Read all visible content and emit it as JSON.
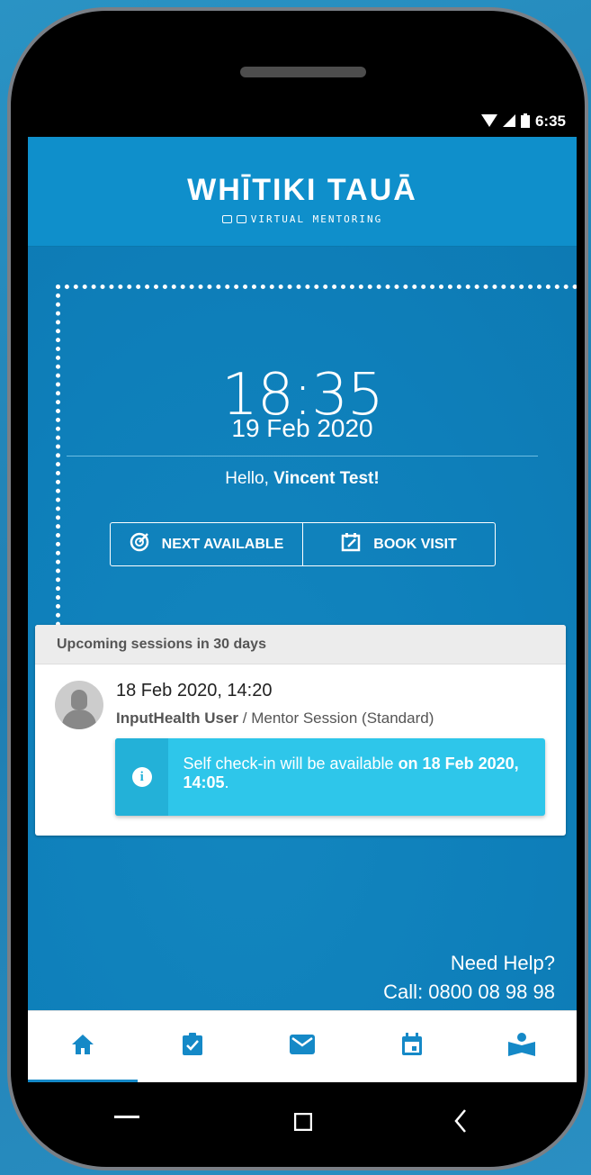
{
  "status_bar": {
    "time": "6:35"
  },
  "header": {
    "brand": "WHĪTIKI TAUĀ",
    "tagline": "VIRTUAL MENTORING"
  },
  "main": {
    "clock": "18:35",
    "date": "19 Feb 2020",
    "greeting": "Hello, ",
    "user_name": "Vincent Test!",
    "actions": [
      {
        "label": "NEXT AVAILABLE",
        "icon": "target-check-icon"
      },
      {
        "label": "BOOK VISIT",
        "icon": "calendar-edit-icon"
      }
    ]
  },
  "upcoming": {
    "title": "Upcoming sessions in 30 days",
    "sessions": [
      {
        "datetime": "18 Feb 2020, 14:20",
        "user": "InputHealth User",
        "type": " / Mentor Session (Standard)",
        "notice_prefix": "Self check-in will be available ",
        "notice_bold": "on 18 Feb 2020, 14:05",
        "notice_suffix": "."
      }
    ]
  },
  "help": {
    "line1": "Need Help?",
    "line2": "Call: 0800 08 98 98"
  },
  "bottom_nav": [
    {
      "name": "home-icon",
      "active": true
    },
    {
      "name": "checklist-icon",
      "active": false
    },
    {
      "name": "mail-icon",
      "active": false
    },
    {
      "name": "calendar-icon",
      "active": false
    },
    {
      "name": "reading-icon",
      "active": false
    }
  ],
  "colors": {
    "accent": "#1589c7",
    "header_bg": "#0f8fcb",
    "notice_bg": "#2ec6ea"
  }
}
